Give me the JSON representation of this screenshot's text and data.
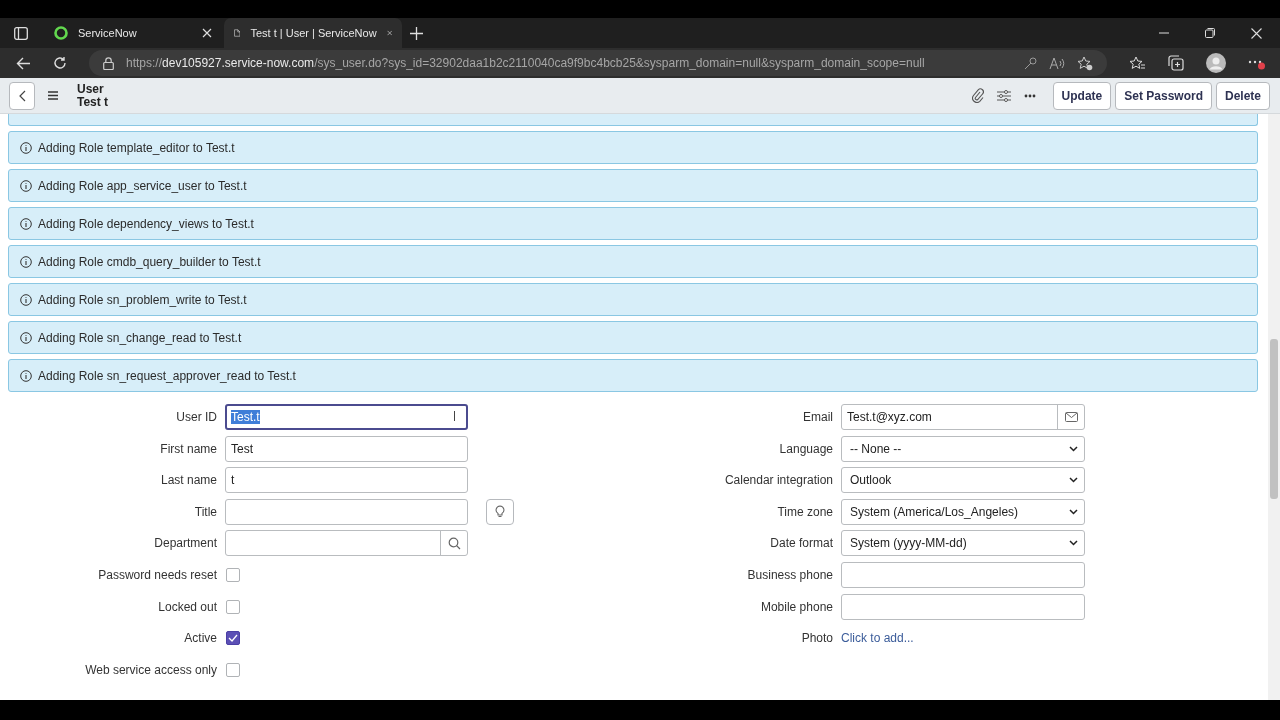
{
  "browser": {
    "tabs": [
      {
        "title": "ServiceNow",
        "selected": false,
        "kind": "site"
      },
      {
        "title": "Test t | User | ServiceNow",
        "selected": true,
        "kind": "page"
      }
    ],
    "url": {
      "scheme": "https://",
      "host": "dev105927.service-now.com",
      "path": "/sys_user.do?sys_id=32902daa1b2c2110040ca9f9bc4bcb25&sysparm_domain=null&sysparm_domain_scope=null"
    }
  },
  "header": {
    "table": "User",
    "record": "Test t",
    "buttons": [
      "Update",
      "Set Password",
      "Delete"
    ]
  },
  "messages": [
    "Adding Role template_editor to Test.t",
    "Adding Role app_service_user to Test.t",
    "Adding Role dependency_views to Test.t",
    "Adding Role cmdb_query_builder to Test.t",
    "Adding Role sn_problem_write to Test.t",
    "Adding Role sn_change_read to Test.t",
    "Adding Role sn_request_approver_read to Test.t"
  ],
  "left_fields": [
    {
      "label": "User ID",
      "kind": "text",
      "value": "Test.t",
      "focused": true
    },
    {
      "label": "First name",
      "kind": "text",
      "value": "Test",
      "focused": false
    },
    {
      "label": "Last name",
      "kind": "text",
      "value": "t",
      "focused": false
    },
    {
      "label": "Title",
      "kind": "suggest",
      "focused": false
    },
    {
      "label": "Department",
      "kind": "reference",
      "focused": false
    },
    {
      "label": "Password needs reset",
      "kind": "checkbox",
      "checked": false
    },
    {
      "label": "Locked out",
      "kind": "checkbox",
      "checked": false
    },
    {
      "label": "Active",
      "kind": "checkbox",
      "checked": true
    },
    {
      "label": "Web service access only",
      "kind": "checkbox",
      "checked": false
    }
  ],
  "right_fields": [
    {
      "label": "Email",
      "kind": "email",
      "value": "Test.t@xyz.com",
      "focused": false
    },
    {
      "label": "Language",
      "kind": "select",
      "value": "-- None --"
    },
    {
      "label": "Calendar integration",
      "kind": "select",
      "value": "Outlook"
    },
    {
      "label": "Time zone",
      "kind": "select",
      "value": "System (America/Los_Angeles)"
    },
    {
      "label": "Date format",
      "kind": "select",
      "value": "System (yyyy-MM-dd)"
    },
    {
      "label": "Business phone",
      "kind": "text",
      "focused": false
    },
    {
      "label": "Mobile phone",
      "kind": "text",
      "focused": false
    },
    {
      "label": "Photo",
      "kind": "link",
      "value": "Click to add..."
    }
  ]
}
